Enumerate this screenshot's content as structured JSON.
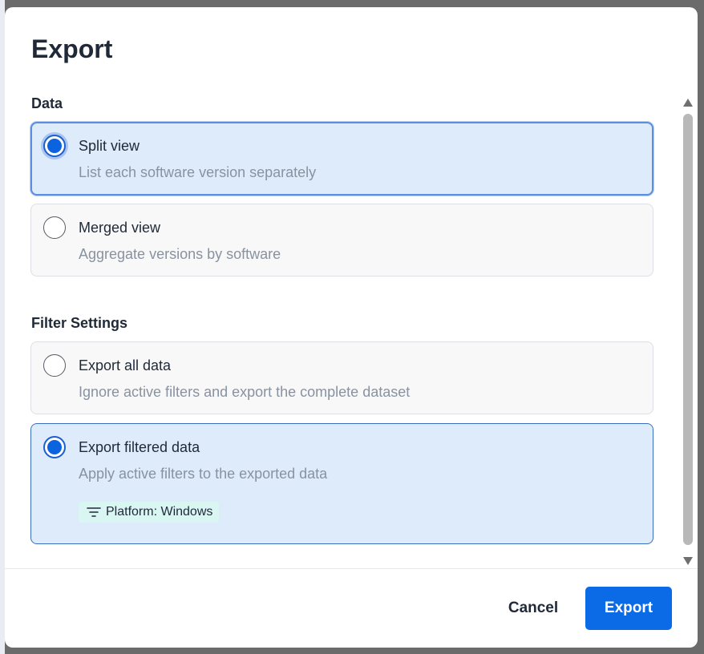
{
  "dialog": {
    "title": "Export",
    "sections": {
      "data": {
        "title": "Data",
        "options": [
          {
            "label": "Split view",
            "description": "List each software version separately",
            "selected": true
          },
          {
            "label": "Merged view",
            "description": "Aggregate versions by software",
            "selected": false
          }
        ]
      },
      "filter": {
        "title": "Filter Settings",
        "options": [
          {
            "label": "Export all data",
            "description": "Ignore active filters and export the complete dataset",
            "selected": false
          },
          {
            "label": "Export filtered data",
            "description": "Apply active filters to the exported data",
            "selected": true,
            "chip": "Platform: Windows",
            "chip_icon": "filter-icon"
          }
        ]
      }
    },
    "footer": {
      "cancel_label": "Cancel",
      "export_label": "Export"
    }
  },
  "colors": {
    "accent": "#0b6ae6",
    "selected_bg": "#deebfb",
    "chip_bg": "#d9f6f3"
  }
}
